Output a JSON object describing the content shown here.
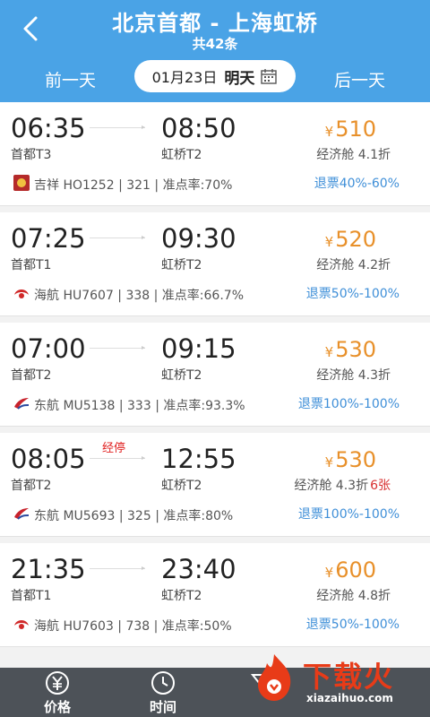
{
  "header": {
    "title": "北京首都 - 上海虹桥",
    "subtitle": "共42条",
    "prev_day": "前一天",
    "next_day": "后一天",
    "date": "01月23日",
    "day_label": "明天"
  },
  "flights": [
    {
      "dep_time": "06:35",
      "arr_time": "08:50",
      "dep_term": "首都T3",
      "arr_term": "虹桥T2",
      "airline": "吉祥 HO1252 | 321 | 准点率:70%",
      "price": "510",
      "cabin": "经济舱 4.1折",
      "refund": "退票40%-60%",
      "stopover": "",
      "seats_left": "",
      "logo": "juneyao-logo-icon"
    },
    {
      "dep_time": "07:25",
      "arr_time": "09:30",
      "dep_term": "首都T1",
      "arr_term": "虹桥T2",
      "airline": "海航 HU7607 | 338 | 准点率:66.7%",
      "price": "520",
      "cabin": "经济舱 4.2折",
      "refund": "退票50%-100%",
      "stopover": "",
      "seats_left": "",
      "logo": "hainan-logo-icon"
    },
    {
      "dep_time": "07:00",
      "arr_time": "09:15",
      "dep_term": "首都T2",
      "arr_term": "虹桥T2",
      "airline": "东航 MU5138 | 333 | 准点率:93.3%",
      "price": "530",
      "cabin": "经济舱 4.3折",
      "refund": "退票100%-100%",
      "stopover": "",
      "seats_left": "",
      "logo": "china-eastern-logo-icon"
    },
    {
      "dep_time": "08:05",
      "arr_time": "12:55",
      "dep_term": "首都T2",
      "arr_term": "虹桥T2",
      "airline": "东航 MU5693 | 325 | 准点率:80%",
      "price": "530",
      "cabin": "经济舱 4.3折",
      "refund": "退票100%-100%",
      "stopover": "经停",
      "seats_left": "6张",
      "logo": "china-eastern-logo-icon"
    },
    {
      "dep_time": "21:35",
      "arr_time": "23:40",
      "dep_term": "首都T1",
      "arr_term": "虹桥T2",
      "airline": "海航 HU7603 | 738 | 准点率:50%",
      "price": "600",
      "cabin": "经济舱 4.8折",
      "refund": "退票50%-100%",
      "stopover": "",
      "seats_left": "",
      "logo": "hainan-logo-icon"
    }
  ],
  "currency": "¥",
  "bottom_tabs": {
    "price": "价格",
    "time": "时间"
  },
  "watermark": {
    "text": "下载火",
    "url": "xiazaihuo.com"
  },
  "colors": {
    "header": "#4aa3e6",
    "price": "#e8902a",
    "refund": "#3f8fd8",
    "alert": "#e02020",
    "bottom_bar": "#4d5258"
  }
}
